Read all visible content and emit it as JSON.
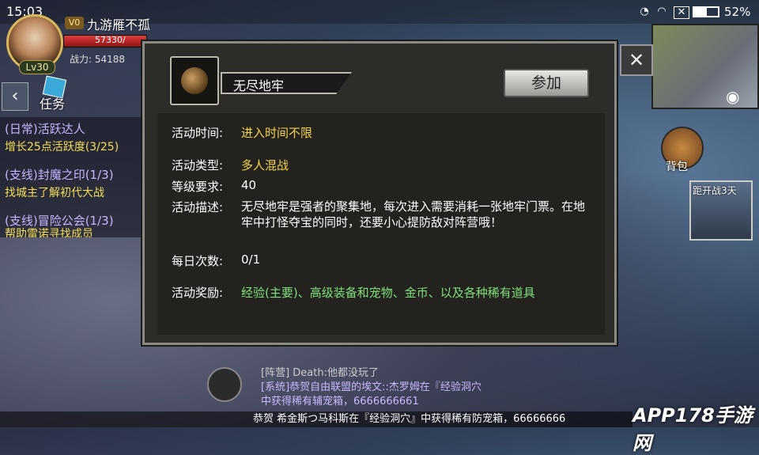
{
  "status_bar": {
    "time": "15:03",
    "battery": "52%"
  },
  "player": {
    "vip": "V0",
    "name": "九游雁不孤",
    "hp": "57330/",
    "hp_fraction": 1.0,
    "power": "战力: 54188",
    "level": "Lv30"
  },
  "quest_panel": {
    "tab_label": "任务",
    "items": [
      {
        "title": "(日常)活跃达人",
        "desc": "增长25点活跃度(3/25)"
      },
      {
        "title": "(支线)封魔之印(1/3)",
        "desc": "找城主了解初代大战"
      },
      {
        "title": "(支线)冒险公会(1/3)",
        "desc": "帮助雷诺寻找成员"
      }
    ]
  },
  "side": {
    "bag_label": "背包",
    "event_label": "距开战3天"
  },
  "dialog": {
    "title": "无尽地牢",
    "join_label": "参加",
    "rows": {
      "time_label": "活动时间:",
      "time_value": "进入时间不限",
      "type_label": "活动类型:",
      "type_value": "多人混战",
      "level_label": "等级要求:",
      "level_value": "40",
      "desc_label": "活动描述:",
      "desc_value": "无尽地牢是强者的聚集地，每次进入需要消耗一张地牢门票。在地牢中打怪夺宝的同时，还要小心提防敌对阵营哦！",
      "daily_label": "每日次数:",
      "daily_value": "0/1",
      "reward_label": "活动奖励:",
      "reward_value": "经验(主要)、高级装备和宠物、金币、以及各种稀有道具"
    },
    "colors": {
      "yellow": "#f3d44a",
      "green": "#7fe07a"
    }
  },
  "chat": {
    "lines": [
      "[阵营] Death:他都没玩了",
      "[系统]恭贺自由联盟的埃文::杰罗姆在『经验洞穴",
      "中获得稀有辅宠箱，6666666661"
    ]
  },
  "ticker": "恭贺 希金斯つ马科斯在『经验洞穴』中获得稀有防宠箱，66666666",
  "watermark": "APP178手游网"
}
